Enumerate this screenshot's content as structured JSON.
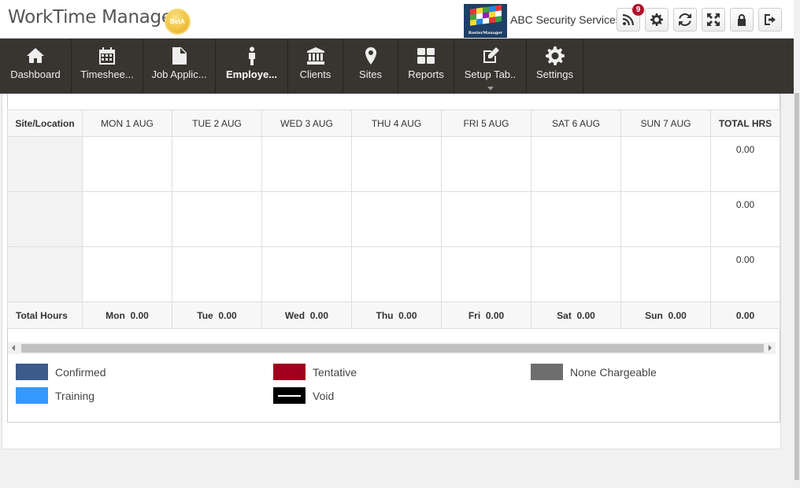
{
  "header": {
    "app_title": "WorkTime Manager",
    "beta_label": "BetA",
    "logo_text": "RosterManager",
    "company_name": "ABC Security Services",
    "notification_count": "9",
    "buttons": [
      "rss-icon",
      "gear-icon",
      "refresh-icon",
      "fullscreen-icon",
      "lock-icon",
      "logout-icon"
    ]
  },
  "nav": {
    "items": [
      {
        "label": "Dashboard",
        "icon": "home-icon"
      },
      {
        "label": "Timeshee...",
        "icon": "calendar-icon"
      },
      {
        "label": "Job Applic...",
        "icon": "document-icon"
      },
      {
        "label": "Employe...",
        "icon": "person-icon",
        "active": true
      },
      {
        "label": "Clients",
        "icon": "bank-icon"
      },
      {
        "label": "Sites",
        "icon": "map-marker-icon"
      },
      {
        "label": "Reports",
        "icon": "grid-icon"
      },
      {
        "label": "Setup Tab..",
        "icon": "edit-icon",
        "dropdown": true
      },
      {
        "label": "Settings",
        "icon": "gear-icon"
      }
    ]
  },
  "schedule": {
    "headers": {
      "site": "Site/Location",
      "days": [
        "MON 1 AUG",
        "TUE 2 AUG",
        "WED 3 AUG",
        "THU 4 AUG",
        "FRI 5 AUG",
        "SAT 6 AUG",
        "SUN 7 AUG"
      ],
      "total": "TOTAL HRS"
    },
    "rows": [
      {
        "site": "",
        "total": "0.00"
      },
      {
        "site": "",
        "total": "0.00"
      },
      {
        "site": "",
        "total": "0.00"
      }
    ],
    "totals": {
      "label": "Total Hours",
      "days": [
        "Mon  0.00",
        "Tue  0.00",
        "Wed  0.00",
        "Thu  0.00",
        "Fri  0.00",
        "Sat  0.00",
        "Sun  0.00"
      ],
      "grand": "0.00"
    }
  },
  "legend": [
    {
      "label": "Confirmed",
      "color": "#3c5a8c"
    },
    {
      "label": "Tentative",
      "color": "#a0001e"
    },
    {
      "label": "None Chargeable",
      "color": "#6e6e6e"
    },
    {
      "label": "Training",
      "color": "#3399ff"
    },
    {
      "label": "Void",
      "color": "#000000"
    }
  ],
  "colors": {
    "nav_bg": "#383530",
    "badge": "#b0102a"
  }
}
